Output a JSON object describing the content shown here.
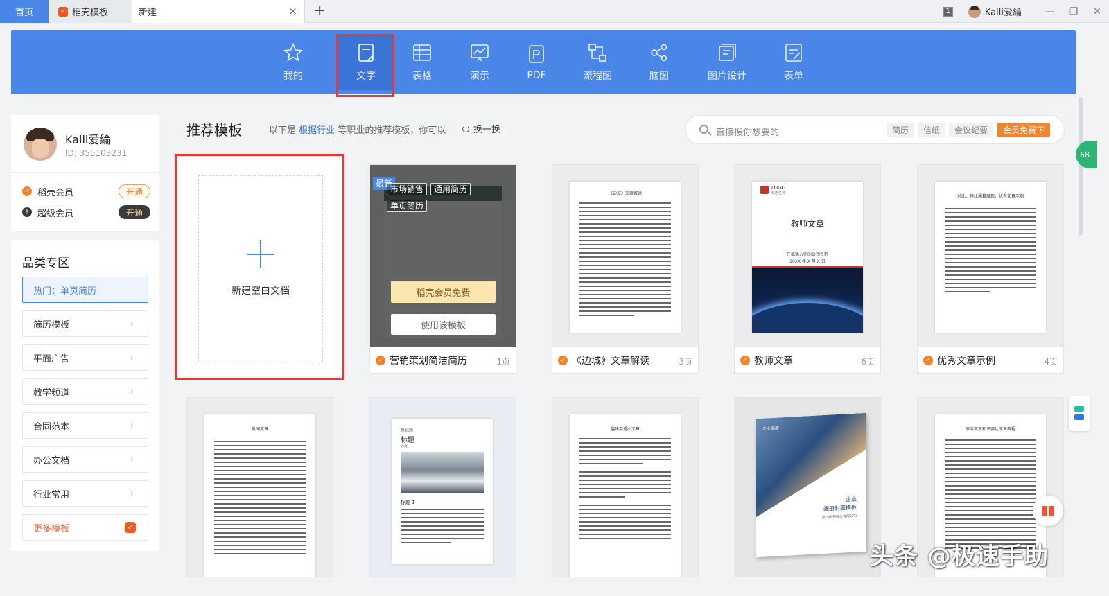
{
  "tabs": {
    "home": "首页",
    "daoke": "稻壳模板",
    "new": "新建",
    "close": "×",
    "add": "+"
  },
  "window": {
    "badge": "1",
    "user": "Kaili爱綸",
    "minimize": "—",
    "restore": "❐",
    "close": "✕"
  },
  "ribbon": {
    "items": [
      {
        "label": "我的",
        "icon": "star-icon"
      },
      {
        "label": "文字",
        "icon": "document-icon"
      },
      {
        "label": "表格",
        "icon": "table-icon"
      },
      {
        "label": "演示",
        "icon": "presentation-icon"
      },
      {
        "label": "PDF",
        "icon": "pdf-icon"
      },
      {
        "label": "流程图",
        "icon": "flowchart-icon"
      },
      {
        "label": "脑图",
        "icon": "mindmap-icon"
      },
      {
        "label": "图片设计",
        "icon": "image-design-icon"
      },
      {
        "label": "表单",
        "icon": "form-icon"
      }
    ],
    "active": "文字"
  },
  "profile": {
    "name": "Kaili爱綸",
    "id": "ID: 355103231",
    "members": [
      {
        "label": "稻壳会员",
        "button": "开通"
      },
      {
        "label": "超级会员",
        "button": "开通"
      }
    ]
  },
  "category": {
    "title": "品类专区",
    "items": [
      "热门：单页简历",
      "简历模板",
      "平面广告",
      "教学频道",
      "合同范本",
      "办公文档",
      "行业常用",
      "更多模板"
    ]
  },
  "main": {
    "title": "推荐模板",
    "subtitle_pre": "以下是",
    "subtitle_link": "根据行业",
    "subtitle_post": "等职业的推荐模板，你可以",
    "refresh": "换一换"
  },
  "search": {
    "placeholder": "直接搜你想要的",
    "tags": [
      "简历",
      "信纸",
      "会议纪要"
    ],
    "vip": "会员免费下"
  },
  "blank": {
    "label": "新建空白文档"
  },
  "cards": [
    {
      "title": "营销策划简洁简历",
      "pages": "1页",
      "tags": [
        "市场销售",
        "通用简历",
        "单页简历"
      ],
      "new_badge": "最新",
      "btn_vip": "稻壳会员免费",
      "btn_use": "使用该模板"
    },
    {
      "title": "《边城》文章解读",
      "pages": "3页",
      "doc_heading": "《边城》文章解读"
    },
    {
      "title": "教师文章",
      "pages": "6页",
      "doc_heading": "教师文章",
      "doc_logo": "LOGO",
      "doc_logo_sub": "标志名称",
      "doc_company": "在此输入你的公司名称",
      "doc_date": "20XX 年 X 月 X 日"
    },
    {
      "title": "优秀文章示例",
      "pages": "4页",
      "doc_heading": "对比、排比通篇展现，优秀文章示例"
    }
  ],
  "row2": [
    {
      "doc_heading": "爱国文章"
    },
    {
      "doc_label": "新标题",
      "doc_heading": "标题",
      "doc_sub": "作者",
      "doc_h1": "标题 1"
    },
    {
      "doc_heading": "趣味英语小文章"
    },
    {
      "doc_brand": "企业画册",
      "doc_title1": "企业",
      "doc_title2": "画册封面模板",
      "doc_company": "金山稻壳股份有限公司"
    },
    {
      "doc_heading": "原中文章知识强化文章教程"
    }
  ],
  "side": {
    "badge": "68"
  },
  "watermark": "头条 @极速手助"
}
